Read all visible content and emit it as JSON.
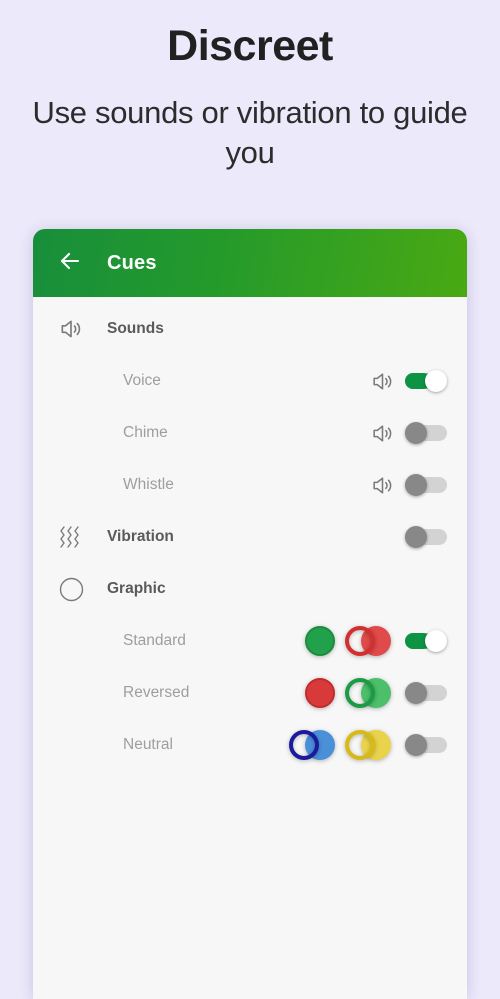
{
  "promo": {
    "title": "Discreet",
    "subtitle": "Use sounds or vibration to guide you"
  },
  "appbar": {
    "title": "Cues",
    "back_icon": "arrow-left-icon",
    "gradient_from": "#188E3C",
    "gradient_to": "#49A913"
  },
  "colors": {
    "background": "#ECE9FB",
    "card": "#F7F7F7",
    "toggle_on": "#0C9444",
    "toggle_off_thumb": "#888888",
    "section_label": "#5A5A5A",
    "item_label": "#9E9E9E",
    "green": "#22A14B",
    "red": "#D32F2F",
    "blue_dark": "#1A1A9E",
    "blue_light": "#4A90D9",
    "gold": "#D9BA15"
  },
  "sections": [
    {
      "label": "Sounds",
      "icon": "speaker-icon",
      "has_toggle": false,
      "items": [
        {
          "label": "Voice",
          "icon": "speaker-icon",
          "toggle": "on"
        },
        {
          "label": "Chime",
          "icon": "speaker-icon",
          "toggle": "off"
        },
        {
          "label": "Whistle",
          "icon": "speaker-icon",
          "toggle": "off"
        }
      ]
    },
    {
      "label": "Vibration",
      "icon": "vibration-waves-icon",
      "has_toggle": true,
      "toggle": "off",
      "items": []
    },
    {
      "label": "Graphic",
      "icon": "circle-outline-icon",
      "has_toggle": false,
      "items": [
        {
          "label": "Standard",
          "toggle": "on",
          "pucks": "green-solid + red-ring-solid"
        },
        {
          "label": "Reversed",
          "toggle": "off",
          "pucks": "red-solid + green-ring-solid"
        },
        {
          "label": "Neutral",
          "toggle": "off",
          "pucks": "blue-ring-solid + gold-ring-solid"
        }
      ]
    }
  ]
}
